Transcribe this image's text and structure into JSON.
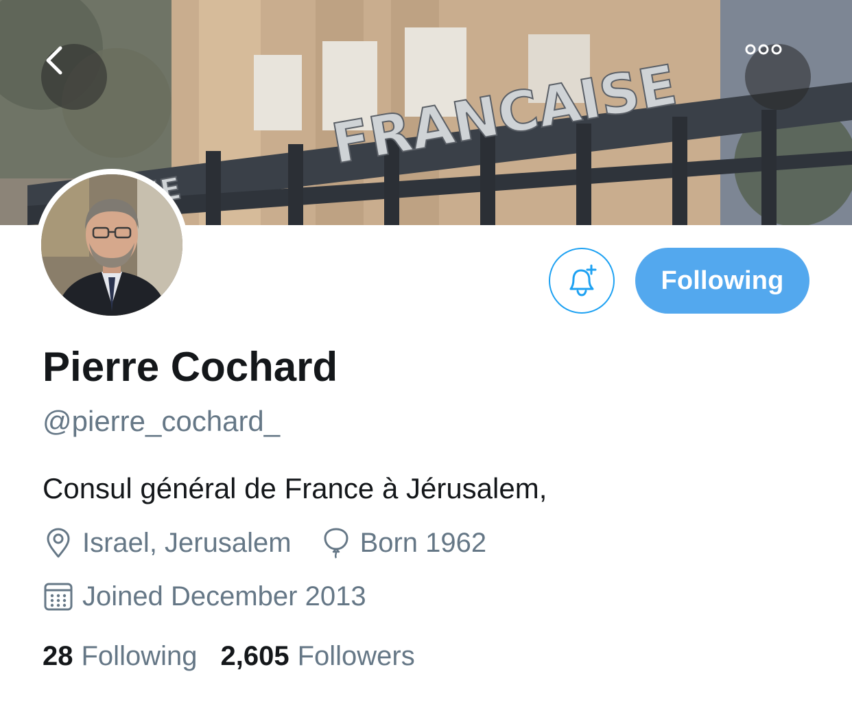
{
  "banner": {
    "sign_word": "FRANCAISE",
    "sign_prefix": "HE"
  },
  "profile": {
    "name": "Pierre Cochard",
    "handle": "@pierre_cochard_",
    "bio": "Consul général de France à Jérusalem,",
    "location": "Israel, Jerusalem",
    "birth": "Born 1962",
    "joined": "Joined December 2013"
  },
  "actions": {
    "following_label": "Following"
  },
  "stats": {
    "following_count": "28",
    "following_label": "Following",
    "followers_count": "2,605",
    "followers_label": "Followers"
  },
  "icons": {
    "back": "chevron-left-icon",
    "more": "more-dots-icon",
    "notify": "bell-plus-icon",
    "location": "location-pin-icon",
    "birthday": "balloon-icon",
    "calendar": "calendar-icon"
  },
  "colors": {
    "accent": "#1da1f2",
    "following_button": "#53a8ee",
    "secondary_text": "#657786",
    "primary_text": "#14171a"
  }
}
